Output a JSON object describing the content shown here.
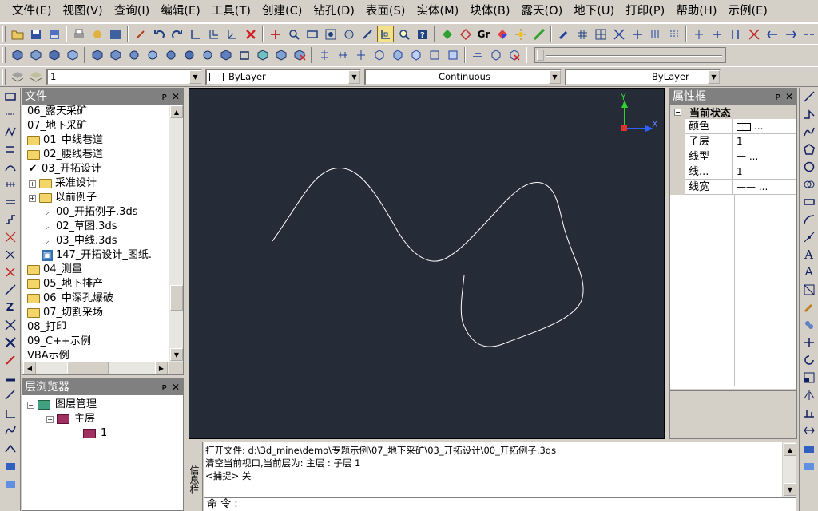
{
  "menu": [
    "文件(E)",
    "视图(V)",
    "查询(I)",
    "编辑(E)",
    "工具(T)",
    "创建(C)",
    "钻孔(D)",
    "表面(S)",
    "实体(M)",
    "块体(B)",
    "露天(O)",
    "地下(U)",
    "打印(P)",
    "帮助(H)",
    "示例(E)"
  ],
  "toolbar": {
    "text_button": "Gr"
  },
  "properties_bar": {
    "layer_value": "1",
    "color_value": "ByLayer",
    "linetype_value": "Continuous",
    "lineweight_value": "ByLayer"
  },
  "file_panel": {
    "title": "文件",
    "items": [
      {
        "label": "06_露天采矿",
        "type": "plain"
      },
      {
        "label": "07_地下采矿",
        "type": "plain"
      },
      {
        "label": "01_中线巷道",
        "type": "folder"
      },
      {
        "label": "02_腰线巷道",
        "type": "folder"
      },
      {
        "label": "03_开拓设计",
        "type": "checked"
      },
      {
        "label": "采准设计",
        "type": "subfolder"
      },
      {
        "label": "以前例子",
        "type": "subfolder"
      },
      {
        "label": "00_开拓例子.3ds",
        "type": "file"
      },
      {
        "label": "02_草图.3ds",
        "type": "file"
      },
      {
        "label": "03_中线.3ds",
        "type": "file"
      },
      {
        "label": "147_开拓设计_图纸.",
        "type": "image"
      },
      {
        "label": "04_测量",
        "type": "folder"
      },
      {
        "label": "05_地下排产",
        "type": "folder"
      },
      {
        "label": "06_中深孔爆破",
        "type": "folder"
      },
      {
        "label": "07_切割采场",
        "type": "folder"
      },
      {
        "label": "08_打印",
        "type": "plain"
      },
      {
        "label": "09_C++示例",
        "type": "plain"
      },
      {
        "label": "VBA示例",
        "type": "plain"
      }
    ]
  },
  "layer_panel": {
    "title": "层浏览器",
    "root": "图层管理",
    "main_layer": "主层",
    "sub_layer": "1"
  },
  "prop_panel": {
    "title": "属性框",
    "section": "当前状态",
    "rows": [
      {
        "key": "颜色",
        "value": "..."
      },
      {
        "key": "子层",
        "value": "1"
      },
      {
        "key": "线型",
        "value": "—  ..."
      },
      {
        "key": "线...",
        "value": "1"
      },
      {
        "key": "线宽",
        "value": "——  ..."
      }
    ]
  },
  "viewport": {
    "axis_y": "Y",
    "axis_x": "X",
    "background": "#262b38",
    "curve_color": "#ffffff"
  },
  "command": {
    "side_label": "信息栏",
    "lines": [
      "打开文件: d:\\3d_mine\\demo\\专题示例\\07_地下采矿\\03_开拓设计\\00_开拓例子.3ds",
      "清空当前视口,当前层为: 主层 : 子层 1",
      "<捕捉> 关"
    ],
    "prompt": "命 令 :"
  }
}
